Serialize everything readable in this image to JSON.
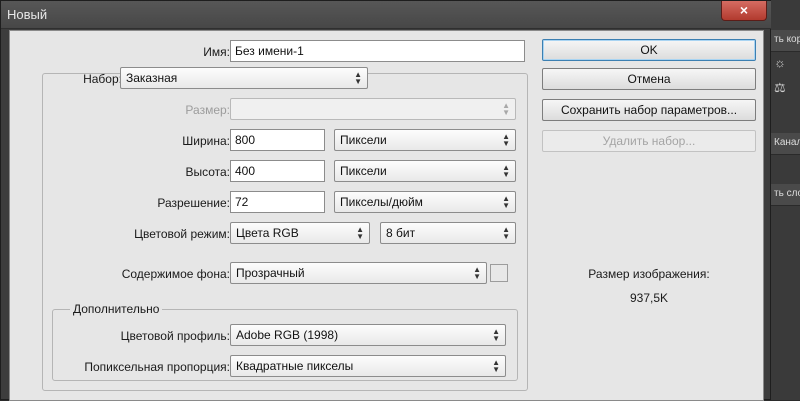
{
  "window": {
    "title": "Новый",
    "close_symbol": "×"
  },
  "background_app": {
    "strip_top": "ть кор",
    "strip_channels": "Канал",
    "strip_layers": "ть сло"
  },
  "form": {
    "name_label": "Имя:",
    "name_value": "Без имени-1",
    "preset_label": "Набор:",
    "preset_value": "Заказная",
    "size_label": "Размер:",
    "size_value": "",
    "width_label": "Ширина:",
    "width_value": "800",
    "width_unit": "Пиксели",
    "height_label": "Высота:",
    "height_value": "400",
    "height_unit": "Пиксели",
    "resolution_label": "Разрешение:",
    "resolution_value": "72",
    "resolution_unit": "Пикселы/дюйм",
    "color_mode_label": "Цветовой режим:",
    "color_mode_value": "Цвета RGB",
    "bit_depth_value": "8 бит",
    "background_label": "Содержимое фона:",
    "background_value": "Прозрачный"
  },
  "advanced": {
    "title": "Дополнительно",
    "profile_label": "Цветовой профиль:",
    "profile_value": "Adobe RGB (1998)",
    "aspect_label": "Попиксельная пропорция:",
    "aspect_value": "Квадратные пикселы"
  },
  "buttons": {
    "ok": "OK",
    "cancel": "Отмена",
    "save_preset": "Сохранить набор параметров...",
    "delete_preset": "Удалить набор..."
  },
  "image_size": {
    "label": "Размер изображения:",
    "value": "937,5K"
  },
  "icons": {
    "dropdown": "dropdown-arrows-icon",
    "close": "close-icon"
  }
}
